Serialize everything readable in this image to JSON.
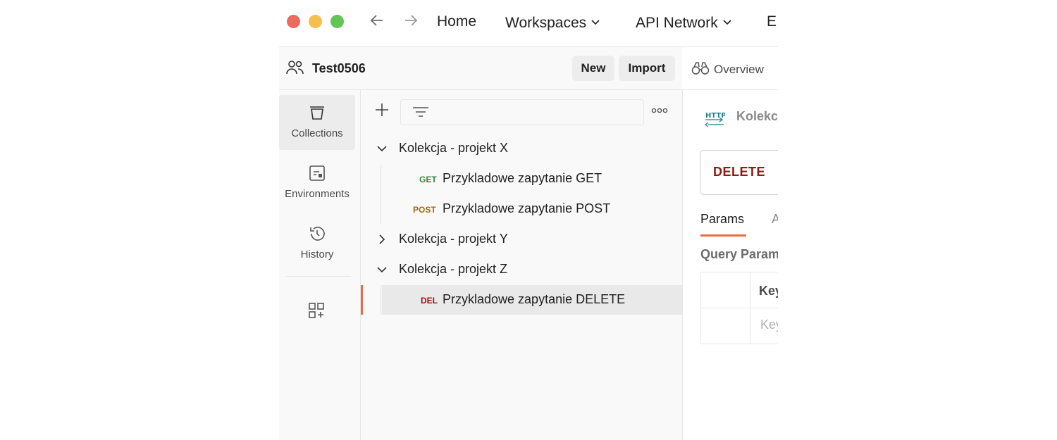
{
  "titlebar": {
    "nav": {
      "home": "Home",
      "workspaces": "Workspaces",
      "api_network": "API Network",
      "explore_truncated": "E"
    }
  },
  "workspace": {
    "name": "Test0506",
    "new_label": "New",
    "import_label": "Import"
  },
  "rail": {
    "items": [
      {
        "label": "Collections",
        "icon": "collections-icon",
        "active": true
      },
      {
        "label": "Environments",
        "icon": "environments-icon"
      },
      {
        "label": "History",
        "icon": "history-icon"
      }
    ],
    "apps_icon": "configure-workbench-icon"
  },
  "tree": {
    "filter_placeholder": "",
    "collections": [
      {
        "name": "Kolekcja - projekt X",
        "expanded": true,
        "requests": [
          {
            "method": "GET",
            "name": "Przykladowe zapytanie GET",
            "method_color": "#2f8a3f"
          },
          {
            "method": "POST",
            "name": "Przykladowe zapytanie POST",
            "method_color": "#a86b00"
          }
        ]
      },
      {
        "name": "Kolekcja - projekt Y",
        "expanded": false,
        "requests": []
      },
      {
        "name": "Kolekcja - projekt Z",
        "expanded": true,
        "requests": [
          {
            "method": "DEL",
            "name": "Przykladowe zapytanie DELETE",
            "method_color": "#8e1a10",
            "selected": true
          }
        ]
      }
    ]
  },
  "content": {
    "overview_label": "Overview",
    "http_icon_text": "HTTP",
    "breadcrumb": "Kolekc",
    "method": "DELETE",
    "tabs": {
      "params": "Params",
      "next_truncated": "A"
    },
    "query_params_title": "Query Param",
    "table": {
      "key_header": "Key",
      "key_placeholder": "Key"
    }
  },
  "colors": {
    "accent": "#ee6b3b",
    "delete_method": "#8e1a10",
    "get_method": "#2f8a3f",
    "post_method": "#a86b00"
  }
}
